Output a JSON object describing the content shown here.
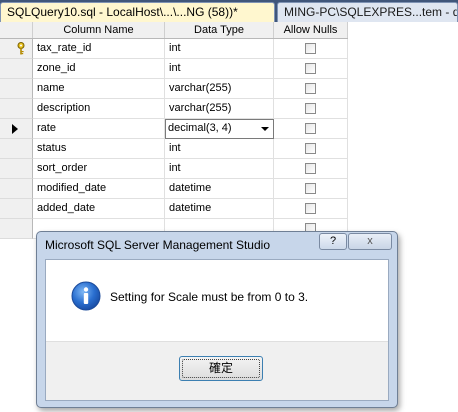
{
  "tabs": [
    {
      "label": "SQLQuery10.sql - LocalHost\\...\\...NG (58))*"
    },
    {
      "label": "MING-PC\\SQLEXPRES...tem - d"
    }
  ],
  "grid": {
    "headers": [
      "Column Name",
      "Data Type",
      "Allow Nulls"
    ],
    "rows": [
      {
        "name": "tax_rate_id",
        "type": "int",
        "allow_nulls": false,
        "is_key": true
      },
      {
        "name": "zone_id",
        "type": "int",
        "allow_nulls": false
      },
      {
        "name": "name",
        "type": "varchar(255)",
        "allow_nulls": false
      },
      {
        "name": "description",
        "type": "varchar(255)",
        "allow_nulls": false
      },
      {
        "name": "rate",
        "type": "decimal(3, 4)",
        "allow_nulls": false,
        "is_current": true
      },
      {
        "name": "status",
        "type": "int",
        "allow_nulls": false
      },
      {
        "name": "sort_order",
        "type": "int",
        "allow_nulls": false
      },
      {
        "name": "modified_date",
        "type": "datetime",
        "allow_nulls": false
      },
      {
        "name": "added_date",
        "type": "datetime",
        "allow_nulls": false
      },
      {
        "name": "",
        "type": "",
        "allow_nulls": false
      }
    ]
  },
  "dialog": {
    "title": "Microsoft SQL Server Management Studio",
    "help_label": "?",
    "close_label": "x",
    "message": "Setting for Scale must be from 0 to 3.",
    "icon": "info-icon",
    "ok_label": "確定"
  }
}
